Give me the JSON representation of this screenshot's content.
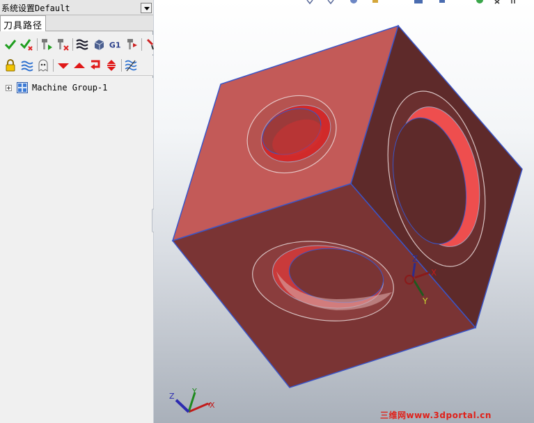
{
  "config_bar": {
    "label": "系统设置Default"
  },
  "tabs": [
    {
      "label": "刀具路径"
    }
  ],
  "toolbar_row1": [
    {
      "icon": "select-all-ops-check-icon"
    },
    {
      "icon": "regenerate-ops-check-icon"
    },
    {
      "icon": "verify-toolpath-icon"
    },
    {
      "icon": "backplot-toolpath-icon"
    },
    {
      "icon": "layers-icon"
    },
    {
      "icon": "simulate-solid-icon"
    },
    {
      "icon": "post-g1-icon",
      "text": "G1"
    },
    {
      "icon": "post-selected-icon"
    },
    {
      "icon": "tool-manager-icon"
    }
  ],
  "toolbar_row2": [
    {
      "icon": "lock-icon"
    },
    {
      "icon": "wave-toolpath-icon"
    },
    {
      "icon": "ghost-display-icon"
    },
    {
      "icon": "move-down-icon"
    },
    {
      "icon": "move-up-icon"
    },
    {
      "icon": "insert-arrow-icon"
    },
    {
      "icon": "expand-collapse-icon"
    },
    {
      "icon": "display-toolpath-icon"
    }
  ],
  "tree": {
    "items": [
      {
        "label": "Machine Group-1",
        "expanded": false
      }
    ]
  },
  "axes": {
    "part": {
      "x": "X",
      "y": "Y",
      "z": "Z"
    },
    "view": {
      "x": "X",
      "y": "Y",
      "z": "Z"
    }
  },
  "watermark": "三维网www.3dportal.cn",
  "colors": {
    "face_top": "#c35a58",
    "face_left": "#7a3434",
    "face_right": "#5e2a2a",
    "edge": "#3a55c8",
    "watermark": "#e0211a"
  }
}
